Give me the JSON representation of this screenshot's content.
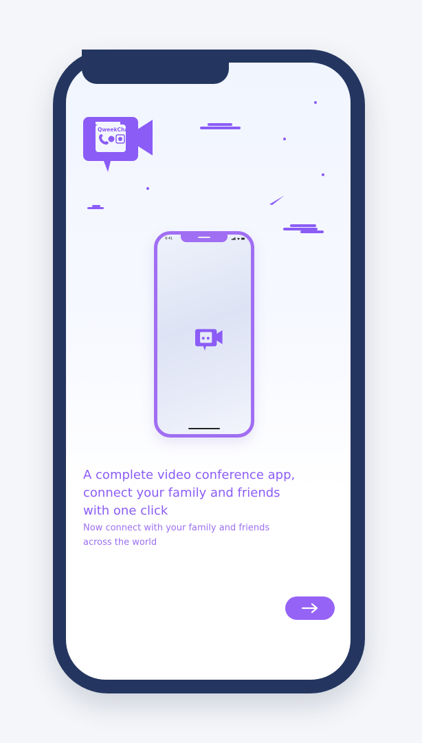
{
  "brand": {
    "logo_text": "QweekChat",
    "accent": "#8b5cf6",
    "frame": "#243660"
  },
  "mini_phone": {
    "time": "9:41"
  },
  "onboarding": {
    "headline_lines": [
      "A complete video conference app,",
      "connect your family and friends",
      "with one click"
    ],
    "subtext_lines": [
      "Now connect with your family and friends",
      "across the world"
    ]
  },
  "next_button": {
    "icon": "arrow-right-icon"
  }
}
